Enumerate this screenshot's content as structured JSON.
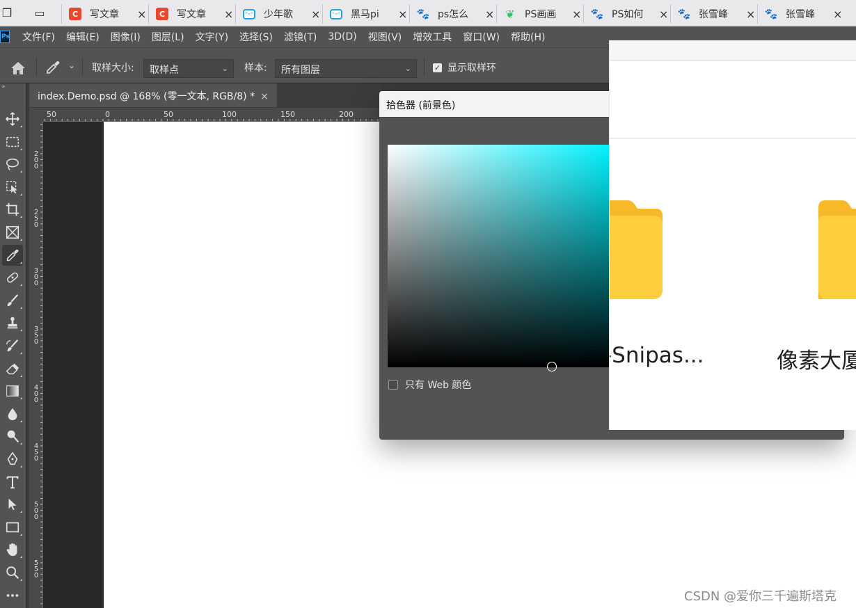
{
  "browser_tabs": [
    {
      "icon": "csdn-icon",
      "label": "写文章"
    },
    {
      "icon": "csdn-icon",
      "label": "写文章"
    },
    {
      "icon": "bilibili-icon",
      "label": "少年歌"
    },
    {
      "icon": "bilibili-icon",
      "label": "黑马pi"
    },
    {
      "icon": "baidu-icon",
      "label": "ps怎么"
    },
    {
      "icon": "leaf-icon",
      "label": "PS画画"
    },
    {
      "icon": "baidu-icon",
      "label": "PS如何"
    },
    {
      "icon": "baidu-icon",
      "label": "张雪峰"
    },
    {
      "icon": "baidu-icon",
      "label": "张雪峰"
    }
  ],
  "ps_logo": "Ps",
  "menu": [
    "文件(F)",
    "编辑(E)",
    "图像(I)",
    "图层(L)",
    "文字(Y)",
    "选择(S)",
    "滤镜(T)",
    "3D(D)",
    "视图(V)",
    "增效工具",
    "窗口(W)",
    "帮助(H)"
  ],
  "options": {
    "sample_size_label": "取样大小:",
    "sample_size_value": "取样点",
    "sample_label": "样本:",
    "sample_value": "所有图层",
    "show_ring_label": "显示取样环",
    "show_ring_checked": true
  },
  "document_tab": {
    "title": "index.Demo.psd @ 168% (零一文本, RGB/8) *"
  },
  "ruler": {
    "h_labels": [
      "50",
      "0",
      "50",
      "100",
      "150",
      "200"
    ],
    "v_labels": [
      "200",
      "250",
      "300",
      "350",
      "400",
      "450",
      "500",
      "550"
    ]
  },
  "tools": [
    "move-tool-icon",
    "marquee-tool-icon",
    "lasso-tool-icon",
    "object-select-tool-icon",
    "crop-tool-icon",
    "frame-tool-icon",
    "eyedropper-tool-icon",
    "healing-tool-icon",
    "brush-tool-icon",
    "stamp-tool-icon",
    "history-brush-tool-icon",
    "eraser-tool-icon",
    "gradient-tool-icon",
    "blur-tool-icon",
    "dodge-tool-icon",
    "pen-tool-icon",
    "type-tool-icon",
    "path-select-tool-icon",
    "rectangle-tool-icon",
    "hand-tool-icon",
    "zoom-tool-icon",
    "more-tools-icon"
  ],
  "picker": {
    "title": "拾色器 (前景色)",
    "web_only_label": "只有 Web 颜色",
    "hue_color": "#00f2ff"
  },
  "explorer": {
    "folders": [
      {
        "label": "-Snipas..."
      },
      {
        "label": "像素大厦"
      }
    ]
  },
  "watermark": "CSDN @爱你三千遍斯塔克"
}
